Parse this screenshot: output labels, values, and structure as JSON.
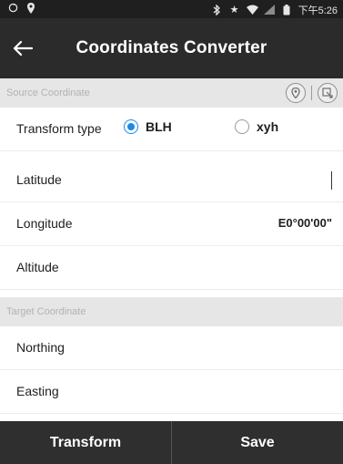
{
  "status_bar": {
    "time": "下午5:26",
    "icons_left": [
      "sync-icon",
      "location-pin-icon"
    ],
    "icons_right": [
      "bluetooth-icon",
      "star-icon",
      "wifi-icon",
      "signal-icon",
      "battery-icon"
    ]
  },
  "app_bar": {
    "title": "Coordinates Converter",
    "back_icon": "arrow-left-icon"
  },
  "source_section": {
    "header": "Source Coordinate",
    "actions": [
      "location-pin-icon",
      "import-icon"
    ]
  },
  "transform_type": {
    "label": "Transform type",
    "options": [
      {
        "label": "BLH",
        "checked": true
      },
      {
        "label": "xyh",
        "checked": false
      }
    ]
  },
  "fields": {
    "latitude": {
      "label": "Latitude",
      "value": ""
    },
    "longitude": {
      "label": "Longitude",
      "value": "E0°00'00\""
    },
    "altitude": {
      "label": "Altitude",
      "value": ""
    }
  },
  "target_section": {
    "header": "Target Coordinate"
  },
  "target_fields": {
    "northing": {
      "label": "Northing",
      "value": ""
    },
    "easting": {
      "label": "Easting",
      "value": ""
    }
  },
  "bottom_bar": {
    "transform_label": "Transform",
    "save_label": "Save"
  },
  "colors": {
    "app_bar": "#2b2b2b",
    "section_header_bg": "#e6e6e6",
    "radio_checked": "#1e88e5",
    "bottom_bar": "#2f2f2f"
  }
}
